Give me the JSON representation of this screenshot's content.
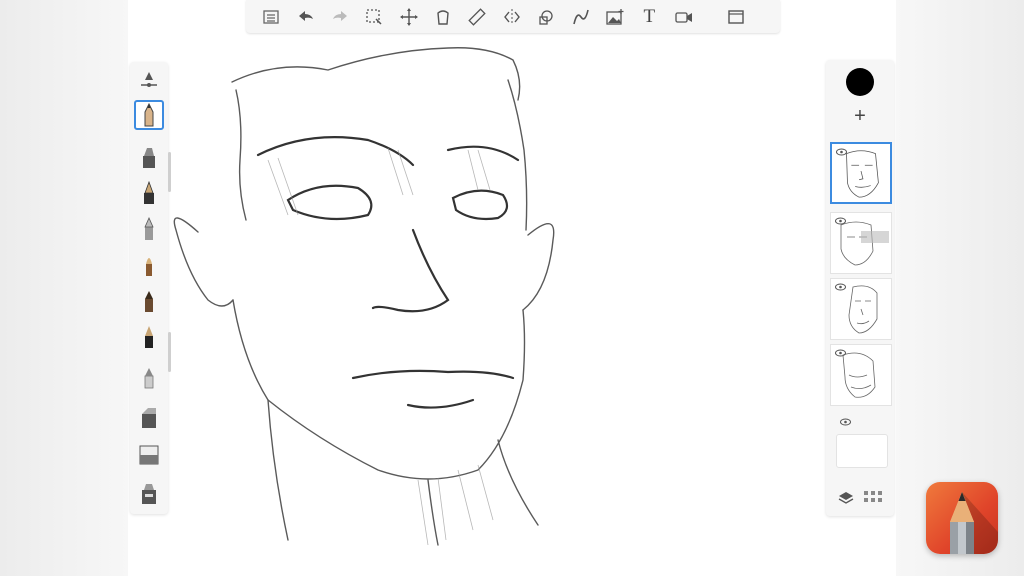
{
  "app": {
    "name": "Sketchbook",
    "accent_color": "#3c8be0",
    "current_color": "#000000"
  },
  "toolbar": {
    "items": [
      {
        "name": "list-icon",
        "label": ""
      },
      {
        "name": "undo-icon",
        "label": ""
      },
      {
        "name": "redo-icon",
        "label": ""
      },
      {
        "name": "selection-icon",
        "label": ""
      },
      {
        "name": "transform-icon",
        "label": ""
      },
      {
        "name": "fill-icon",
        "label": ""
      },
      {
        "name": "ruler-icon",
        "label": ""
      },
      {
        "name": "symmetry-icon",
        "label": ""
      },
      {
        "name": "shapes-icon",
        "label": ""
      },
      {
        "name": "curve-icon",
        "label": ""
      },
      {
        "name": "add-image-icon",
        "label": ""
      },
      {
        "name": "text-icon",
        "label": "T"
      },
      {
        "name": "record-icon",
        "label": ""
      },
      {
        "name": "fullscreen-icon",
        "label": ""
      }
    ]
  },
  "brushes": {
    "items": [
      "brush-size-slider-icon",
      "pencil-brush-icon",
      "marker-brush-icon",
      "ink-pen-icon",
      "ballpoint-icon",
      "paintbrush-icon",
      "charcoal-icon",
      "fine-pen-icon",
      "airbrush-icon",
      "chisel-marker-icon",
      "eraser-icon",
      "library-brush-icon"
    ],
    "selected_index": 1
  },
  "layers": {
    "add_label": "+",
    "items": [
      {
        "name": "layer-1",
        "active": true,
        "visible": true
      },
      {
        "name": "layer-2",
        "active": false,
        "visible": true
      },
      {
        "name": "layer-3",
        "active": false,
        "visible": true
      },
      {
        "name": "layer-4",
        "active": false,
        "visible": true
      },
      {
        "name": "background-layer",
        "active": false,
        "visible": true
      }
    ]
  }
}
